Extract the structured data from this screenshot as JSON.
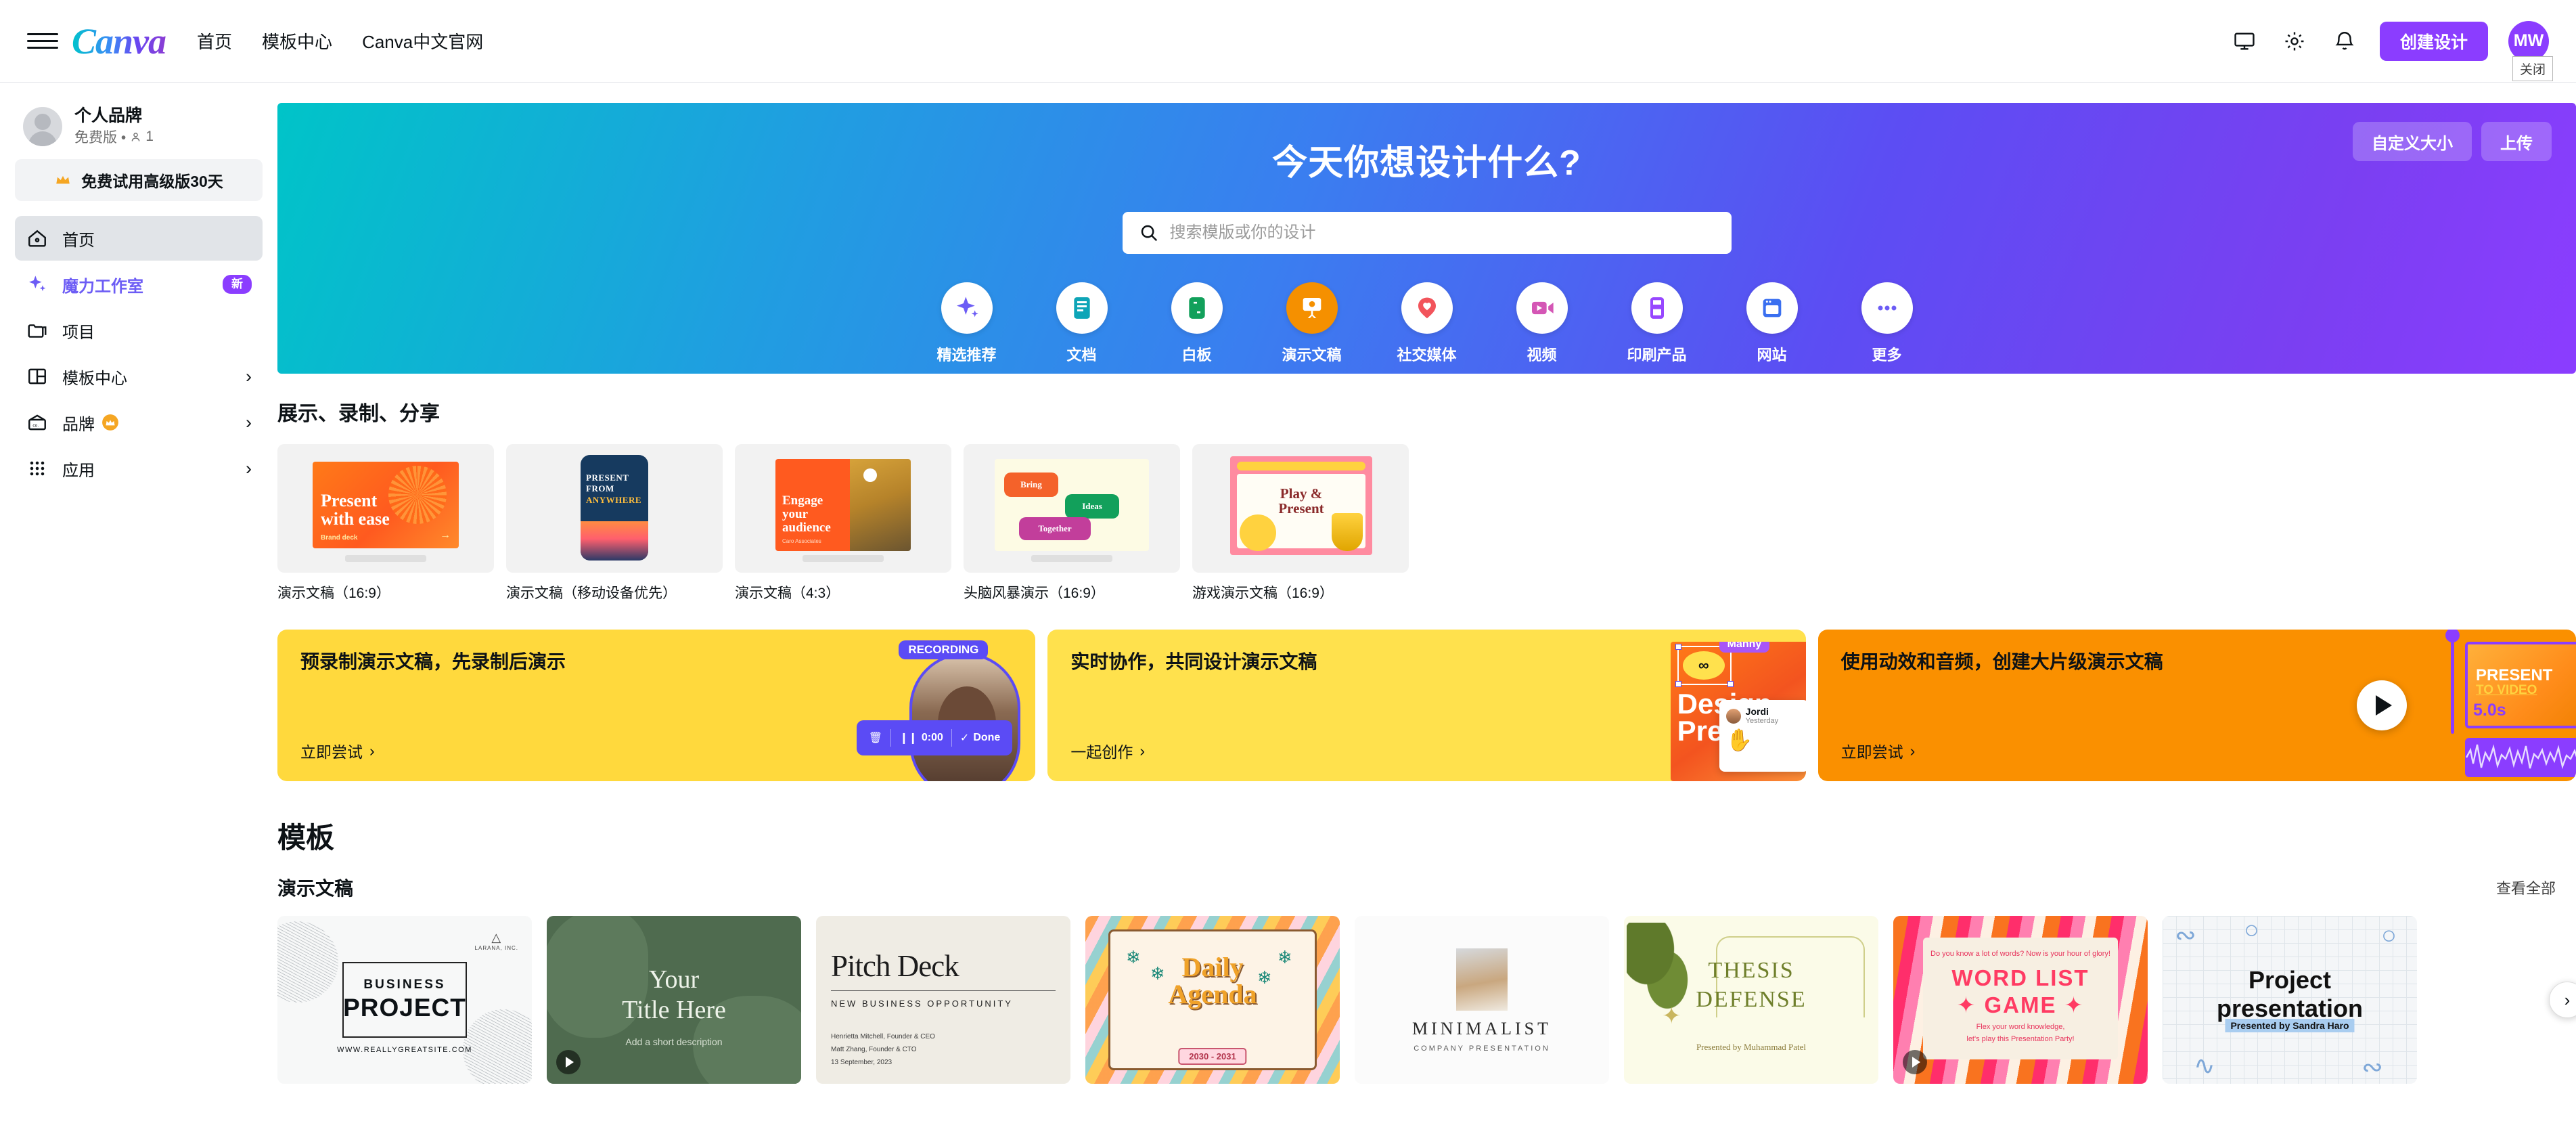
{
  "topbar": {
    "logo": "Canva",
    "nav": [
      {
        "label": "首页"
      },
      {
        "label": "模板中心"
      },
      {
        "label": "Canva中文官网"
      }
    ],
    "icons": [
      {
        "name": "monitor-icon"
      },
      {
        "name": "gear-icon"
      },
      {
        "name": "bell-icon"
      }
    ],
    "create_button": "创建设计",
    "avatar_initials": "MW",
    "tooltip": "关闭"
  },
  "sidebar": {
    "profile": {
      "name": "个人品牌",
      "plan": "免费版 •",
      "members": "1"
    },
    "trial_button": "免费试用高级版30天",
    "items": [
      {
        "label": "首页",
        "icon": "home-icon",
        "active": true,
        "chevron": false
      },
      {
        "label": "魔力工作室",
        "icon": "sparkle-icon",
        "badge": "新",
        "active": false,
        "chevron": false
      },
      {
        "label": "项目",
        "icon": "folder-icon",
        "active": false,
        "chevron": false
      },
      {
        "label": "模板中心",
        "icon": "template-icon",
        "active": false,
        "chevron": true
      },
      {
        "label": "品牌",
        "icon": "brand-icon",
        "crown": true,
        "active": false,
        "chevron": true
      },
      {
        "label": "应用",
        "icon": "apps-icon",
        "active": false,
        "chevron": true
      }
    ]
  },
  "hero": {
    "title": "今天你想设计什么?",
    "custom_size_button": "自定义大小",
    "upload_button": "上传",
    "search_placeholder": "搜索模版或你的设计",
    "search_value": "",
    "categories": [
      {
        "label": "精选推荐",
        "icon": "sparkle-icon",
        "color": "#6c5cf5",
        "active": false
      },
      {
        "label": "文档",
        "icon": "doc-icon",
        "color": "#0ea5b7",
        "active": false
      },
      {
        "label": "白板",
        "icon": "whiteboard-icon",
        "color": "#12a05b",
        "active": false
      },
      {
        "label": "演示文稿",
        "icon": "presentation-icon",
        "color": "#f59000",
        "active": true
      },
      {
        "label": "社交媒体",
        "icon": "heart-pin-icon",
        "color": "#f2545b",
        "active": false
      },
      {
        "label": "视频",
        "icon": "video-icon",
        "color": "#d456b5",
        "active": false
      },
      {
        "label": "印刷产品",
        "icon": "print-icon",
        "color": "#9747ff",
        "active": false
      },
      {
        "label": "网站",
        "icon": "website-icon",
        "color": "#3a6ff0",
        "active": false
      },
      {
        "label": "更多",
        "icon": "more-dots-icon",
        "color": "#6c5cf5",
        "active": false
      }
    ]
  },
  "formats_section": {
    "heading": "展示、录制、分享",
    "cards": [
      {
        "caption": "演示文稿（16:9）",
        "art": "present-with-ease",
        "lines": [
          "Present",
          "with ease"
        ],
        "brand": "Brand deck"
      },
      {
        "caption": "演示文稿（移动设备优先）",
        "art": "present-from-anywhere",
        "lines": [
          "PRESENT",
          "FROM",
          "ANYWHERE"
        ]
      },
      {
        "caption": "演示文稿（4:3）",
        "art": "engage-your-audience",
        "lines": [
          "Engage",
          "your",
          "audience"
        ],
        "sub": "Caro Associates"
      },
      {
        "caption": "头脑风暴演示（16:9）",
        "art": "brainstorm",
        "chips": [
          "Bring",
          "Ideas",
          "Together"
        ]
      },
      {
        "caption": "游戏演示文稿（16:9）",
        "art": "play-and-present",
        "lines": [
          "Play &",
          "Present"
        ]
      }
    ]
  },
  "promos": [
    {
      "title": "预录制演示文稿，先录制后演示",
      "cta": "立即尝试",
      "theme": "yellow",
      "badge": "RECORDING",
      "timer": "0:00",
      "done_label": "Done"
    },
    {
      "title": "实时协作，共同设计演示文稿",
      "cta": "一起创作",
      "theme": "yellow2",
      "cursor_label": "Manny",
      "comment_name": "Jordi",
      "comment_time": "Yesterday",
      "slide_text": "Design Prese"
    },
    {
      "title": "使用动效和音频，创建大片级演示文稿",
      "cta": "立即尝试",
      "theme": "orange",
      "duration": "5.0s",
      "slide_line1": "PRESENT",
      "slide_line2": "TO VIDEO"
    }
  ],
  "templates_section": {
    "heading": "模板",
    "subheading": "演示文稿",
    "see_all": "查看全部",
    "items": [
      {
        "art": "business-project",
        "title_a": "BUSINESS",
        "title_b": "PROJECT",
        "url": "WWW.REALLYGREATSITE.COM",
        "brand": "LARANA, INC.",
        "has_play": false
      },
      {
        "art": "your-title-here",
        "title": "Your\nTitle Here",
        "sub": "Add a short description",
        "has_play": true
      },
      {
        "art": "pitch-deck",
        "title": "Pitch Deck",
        "sub": "NEW BUSINESS OPPORTUNITY",
        "meta": "Henrietta Mitchell, Founder & CEO\nMatt Zhang, Founder & CTO\n13 September, 2023",
        "has_play": false
      },
      {
        "art": "daily-agenda",
        "title": "Daily\nAgenda",
        "years": "2030 - 2031",
        "has_play": false
      },
      {
        "art": "minimalist",
        "title": "MINIMALIST",
        "sub": "COMPANY PRESENTATION",
        "has_play": false
      },
      {
        "art": "thesis-defense",
        "title": "THESIS\nDEFENSE",
        "sub": "Presented by Muhammad Patel",
        "has_play": false
      },
      {
        "art": "word-list-game",
        "top": "Do you know a lot of words? Now is your hour of glory!",
        "title": "WORD LIST\n✦ GAME ✦",
        "bottom": "Flex your word knowledge,\nlet's play this Presentation Party!",
        "has_play": true
      },
      {
        "art": "project-presentation",
        "title": "Project\npresentation",
        "sub": "Presented by Sandra Haro",
        "has_play": false
      }
    ],
    "next_arrow": "›"
  }
}
